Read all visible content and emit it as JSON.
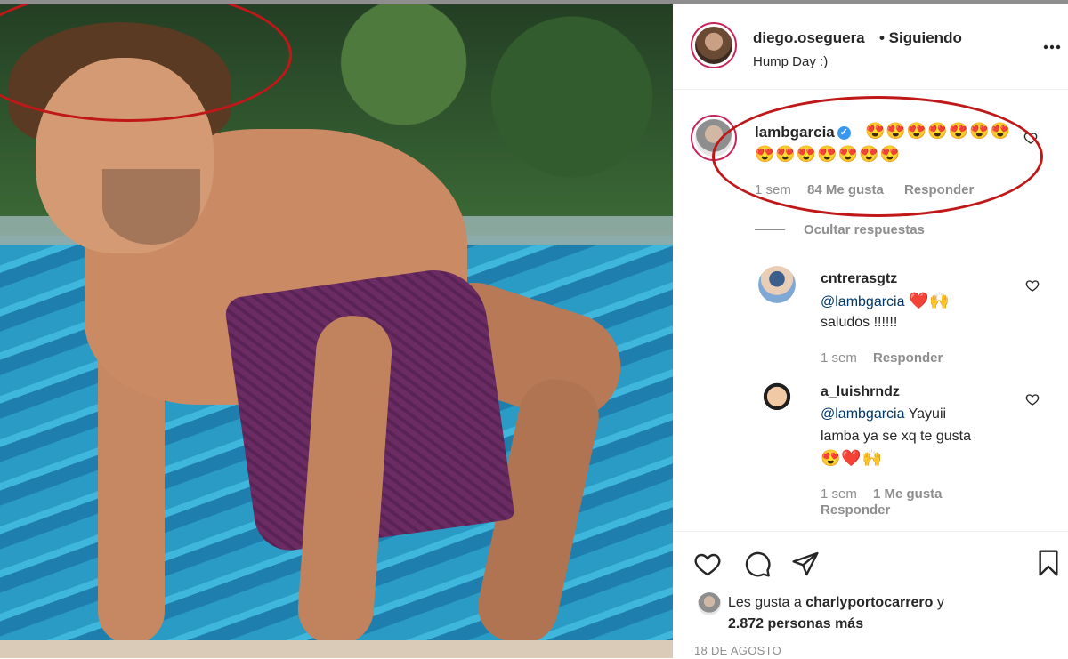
{
  "post": {
    "author": "diego.oseguera",
    "following": "• Siguiendo",
    "caption": "Hump Day :)"
  },
  "comment": {
    "user": "lambgarcia",
    "emojis_line1": "😍😍😍😍😍😍😍",
    "emojis_line2": "😍😍😍😍😍😍😍",
    "time": "1 sem",
    "likes": "84 Me gusta",
    "reply": "Responder",
    "hide_replies": "Ocultar respuestas"
  },
  "replies": [
    {
      "user": "cntrerasgtz",
      "mention": "@lambgarcia",
      "emojis": "❤️🙌",
      "text": "saludos !!!!!!",
      "time": "1 sem",
      "reply": "Responder"
    },
    {
      "user": "a_luishrndz",
      "mention": "@lambgarcia",
      "text_inline": "Yayuii",
      "text_line2": "lamba ya se xq te gusta",
      "emojis": "😍❤️🙌",
      "time": "1 sem",
      "likes": "1 Me gusta",
      "reply": "Responder"
    }
  ],
  "likes": {
    "prefix": "Les gusta a",
    "user": "charlyportocarrero",
    "suffix": "y",
    "count": "2.872 personas más"
  },
  "date": "18 DE AGOSTO",
  "icons": {
    "more": "more-options-icon",
    "like": "heart-icon",
    "comment": "comment-icon",
    "share": "share-icon",
    "save": "bookmark-icon"
  },
  "colors": {
    "annotation": "#c01818",
    "link": "#00376b",
    "verified": "#3897f0"
  }
}
